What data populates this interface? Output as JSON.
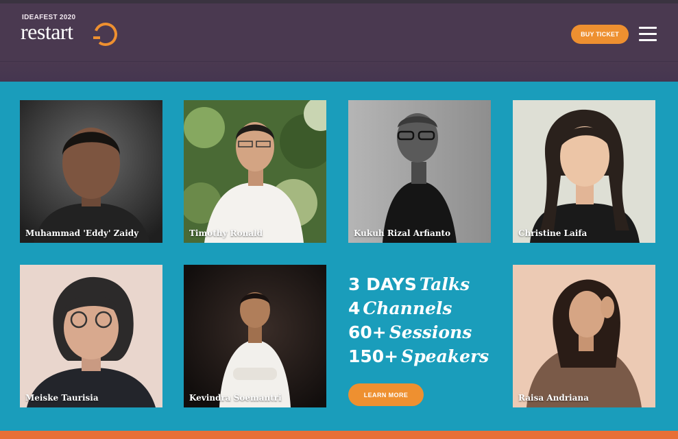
{
  "header": {
    "logo_small": "IDEAFEST 2020",
    "logo_word": "restart",
    "buy_ticket_label": "BUY TICKET",
    "menu_icon": "hamburger-menu-icon"
  },
  "speakers": [
    {
      "name": "Muhammad 'Eddy' Zaidy"
    },
    {
      "name": "Timothy Ronald"
    },
    {
      "name": "Kukuh Rizal Arfianto"
    },
    {
      "name": "Christine Laifa"
    },
    {
      "name": "Meiske Taurisia"
    },
    {
      "name": "Kevindra Soemantri"
    },
    {
      "name": "Raisa Andriana"
    }
  ],
  "stats": [
    {
      "number": "3 DAYS",
      "word": "Talks"
    },
    {
      "number": "4",
      "word": "Channels"
    },
    {
      "number": "60+",
      "word": "Sessions"
    },
    {
      "number": "150+",
      "word": "Speakers"
    }
  ],
  "learn_more_label": "LEARN MORE",
  "colors": {
    "header_bg": "#4a3950",
    "section_bg": "#1a9dbb",
    "accent": "#ee9030",
    "footer_bar": "#e86f36"
  }
}
